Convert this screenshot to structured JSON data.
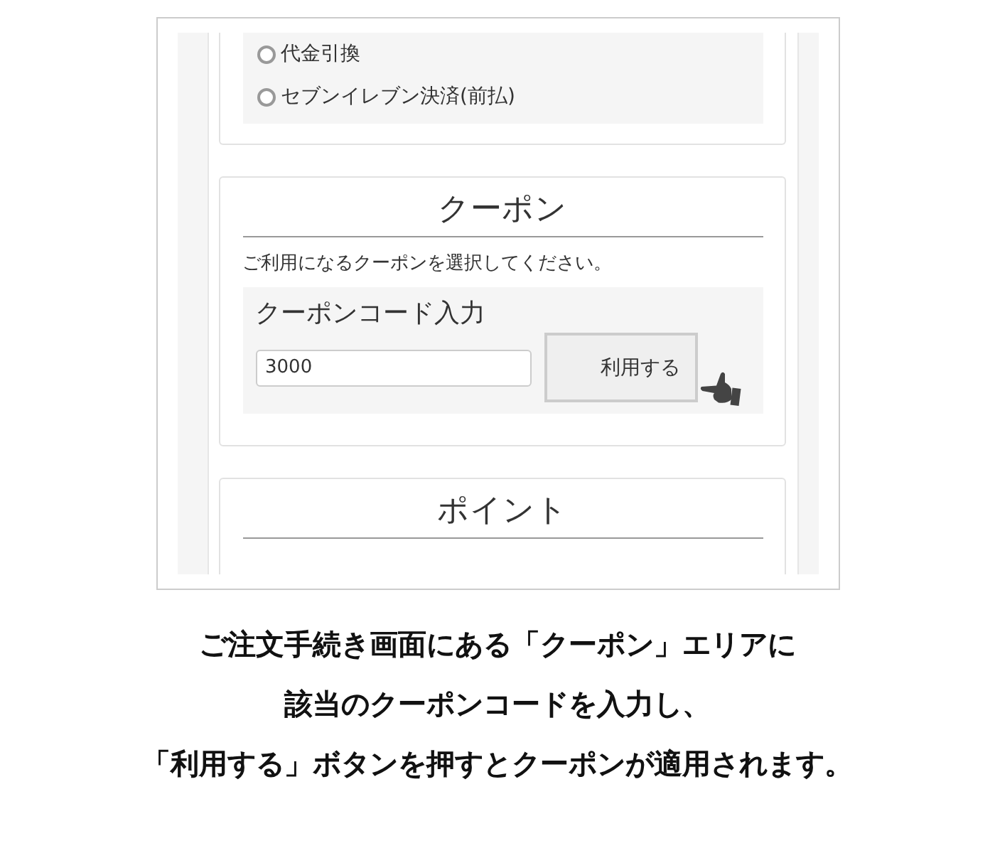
{
  "payment": {
    "options": [
      {
        "label": "代金引換",
        "selected": false
      },
      {
        "label": "セブンイレブン決済(前払)",
        "selected": false
      }
    ]
  },
  "coupon": {
    "title": "クーポン",
    "instruction": "ご利用になるクーポンを選択してください。",
    "code_label": "クーポンコード入力",
    "code_value": "3000",
    "apply_button": "利用する"
  },
  "points": {
    "title": "ポイント"
  },
  "caption": [
    "ご注文手続き画面にある「クーポン」エリアに",
    "該当のクーポンコードを入力し、",
    "「利用する」ボタンを押すとクーポンが適用されます。"
  ]
}
